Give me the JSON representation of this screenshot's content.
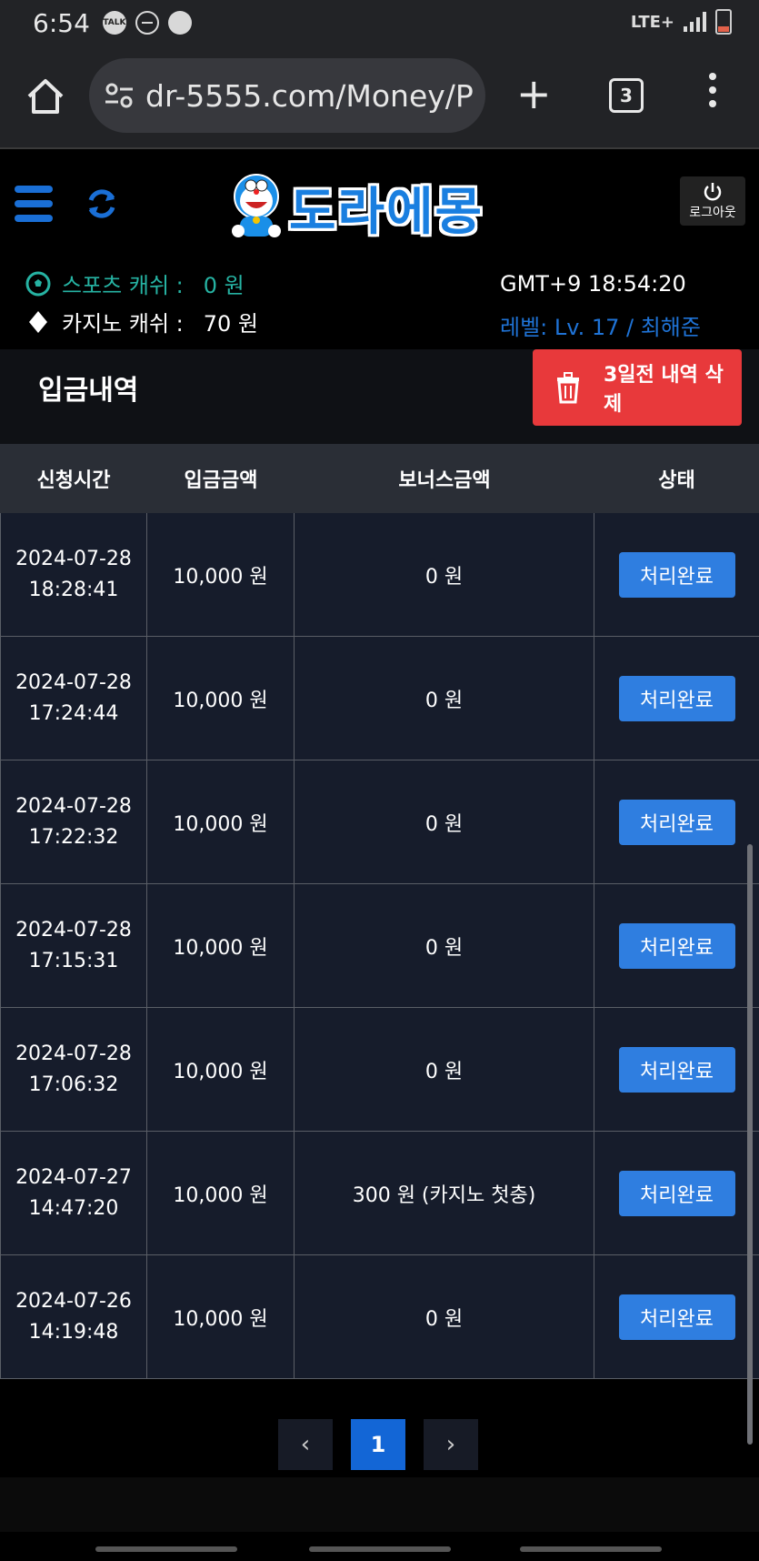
{
  "status_bar": {
    "time": "6:54",
    "talk_badge": "TALK",
    "network": "LTE+"
  },
  "browser": {
    "url": "dr-5555.com/Money/P",
    "tab_count": "3"
  },
  "header": {
    "logo_text": "도라에몽",
    "logout_label": "로그아웃",
    "sports_cash_label": "스포츠 캐쉬 :",
    "sports_cash_value": "0 원",
    "casino_cash_label": "카지노 캐쉬 :",
    "casino_cash_value": "70 원",
    "clock": "GMT+9 18:54:20",
    "level": "레벨: Lv. 17 / 최해준"
  },
  "page": {
    "title": "입금내역",
    "delete_button": "3일전 내역 삭제"
  },
  "table": {
    "columns": [
      "신청시간",
      "입금금액",
      "보너스금액",
      "상태"
    ],
    "rows": [
      {
        "date": "2024-07-28",
        "time": "18:28:41",
        "amount": "10,000 원",
        "bonus": "0 원",
        "status": "처리완료"
      },
      {
        "date": "2024-07-28",
        "time": "17:24:44",
        "amount": "10,000 원",
        "bonus": "0 원",
        "status": "처리완료"
      },
      {
        "date": "2024-07-28",
        "time": "17:22:32",
        "amount": "10,000 원",
        "bonus": "0 원",
        "status": "처리완료"
      },
      {
        "date": "2024-07-28",
        "time": "17:15:31",
        "amount": "10,000 원",
        "bonus": "0 원",
        "status": "처리완료"
      },
      {
        "date": "2024-07-28",
        "time": "17:06:32",
        "amount": "10,000 원",
        "bonus": "0 원",
        "status": "처리완료"
      },
      {
        "date": "2024-07-27",
        "time": "14:47:20",
        "amount": "10,000 원",
        "bonus": "300 원 (카지노 첫충)",
        "status": "처리완료"
      },
      {
        "date": "2024-07-26",
        "time": "14:19:48",
        "amount": "10,000 원",
        "bonus": "0 원",
        "status": "처리완료"
      }
    ]
  },
  "pagination": {
    "prev": "‹",
    "current": "1",
    "next": "›"
  },
  "colors": {
    "accent_blue": "#1f73d6",
    "delete_red": "#e8393b",
    "sports_teal": "#26b3a3",
    "status_button": "#2f7ee0"
  }
}
